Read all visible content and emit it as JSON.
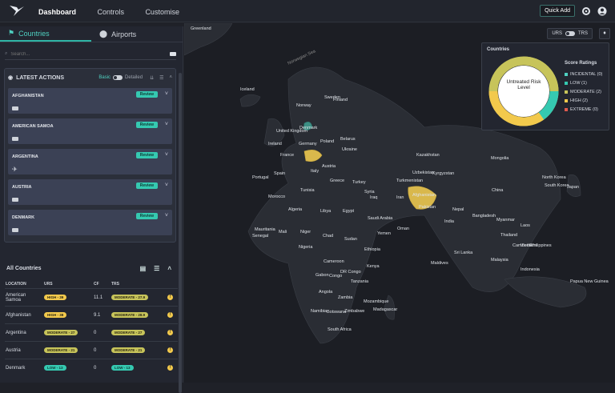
{
  "nav": {
    "dashboard": "Dashboard",
    "controls": "Controls",
    "customise": "Customise"
  },
  "topbar": {
    "quick_add": "Quick Add"
  },
  "panel": {
    "tabs": [
      "Countries",
      "Airports"
    ],
    "search_placeholder": "Search...",
    "latest_actions": {
      "title": "LATEST ACTIONS",
      "basic": "Basic",
      "detailed": "Detailed",
      "cards": [
        {
          "name": "AFGHANISTAN",
          "action": "Review"
        },
        {
          "name": "AMERICAN SAMOA",
          "action": "Review"
        },
        {
          "name": "ARGENTINA",
          "action": "Review"
        },
        {
          "name": "AUSTRIA",
          "action": "Review"
        },
        {
          "name": "DENMARK",
          "action": "Review"
        }
      ]
    },
    "all_countries": {
      "title": "All Countries",
      "columns": [
        "LOCATION",
        "URS",
        "CF",
        "TRS"
      ],
      "rows": [
        {
          "location": "American Samoa",
          "urs": "HIGH - 39",
          "urs_level": "high",
          "cf": "11.1",
          "trs": "MODERATE - 27.9",
          "trs_level": "mod"
        },
        {
          "location": "Afghanistan",
          "urs": "HIGH - 38",
          "urs_level": "high",
          "cf": "9.1",
          "trs": "MODERATE - 28.9",
          "trs_level": "mod"
        },
        {
          "location": "Argentina",
          "urs": "MODERATE - 27",
          "urs_level": "mod",
          "cf": "0",
          "trs": "MODERATE - 27",
          "trs_level": "mod"
        },
        {
          "location": "Austria",
          "urs": "MODERATE - 21",
          "urs_level": "mod",
          "cf": "0",
          "trs": "MODERATE - 21",
          "trs_level": "mod"
        },
        {
          "location": "Denmark",
          "urs": "LOW - 13",
          "urs_level": "low",
          "cf": "0",
          "trs": "LOW - 13",
          "trs_level": "low"
        }
      ]
    }
  },
  "map": {
    "toggle_left": "URS",
    "toggle_right": "TRS",
    "labels": [
      "Greenland",
      "Norwegian Sea",
      "Iceland",
      "Norway",
      "Sweden",
      "Finland",
      "Denmark",
      "United Kingdom",
      "Ireland",
      "Germany",
      "Poland",
      "Belarus",
      "Ukraine",
      "France",
      "Italy",
      "Spain",
      "Portugal",
      "Austria",
      "Greece",
      "Turkey",
      "Kazakhstan",
      "Mongolia",
      "Uzbekistan",
      "Kyrgyzstan",
      "Turkmenistan",
      "Afghanistan",
      "Pakistan",
      "Iran",
      "Iraq",
      "Syria",
      "Algeria",
      "Libya",
      "Egypt",
      "Tunisia",
      "Morocco",
      "Saudi Arabia",
      "Yemen",
      "Oman",
      "Mali",
      "Niger",
      "Chad",
      "Sudan",
      "Ethiopia",
      "Nigeria",
      "Mauritania",
      "Senegal",
      "Cameroon",
      "Gabon",
      "Congo",
      "DR Congo",
      "Kenya",
      "Tanzania",
      "Angola",
      "Zambia",
      "Namibia",
      "Botswana",
      "Zimbabwe",
      "Mozambique",
      "Madagascar",
      "South Africa",
      "India",
      "China",
      "Nepal",
      "Bangladesh",
      "Myanmar",
      "Thailand",
      "Laos",
      "Vietnam",
      "Cambodia",
      "Philippines",
      "Malaysia",
      "Sri Lanka",
      "Maldives",
      "Indonesia",
      "Japan",
      "South Korea",
      "North Korea",
      "Papua New Guinea"
    ],
    "legend": {
      "title": "Countries",
      "center_label": "Untreated Risk Level",
      "ratings_title": "Score Ratings",
      "items": [
        {
          "label": "INCIDENTAL (0)",
          "color": "#4fd1c1"
        },
        {
          "label": "LOW (1)",
          "color": "#35c9b1"
        },
        {
          "label": "MODERATE (2)",
          "color": "#c7c45a"
        },
        {
          "label": "HIGH (2)",
          "color": "#f2c94c"
        },
        {
          "label": "EXTREME (0)",
          "color": "#e05a4f"
        }
      ]
    }
  }
}
